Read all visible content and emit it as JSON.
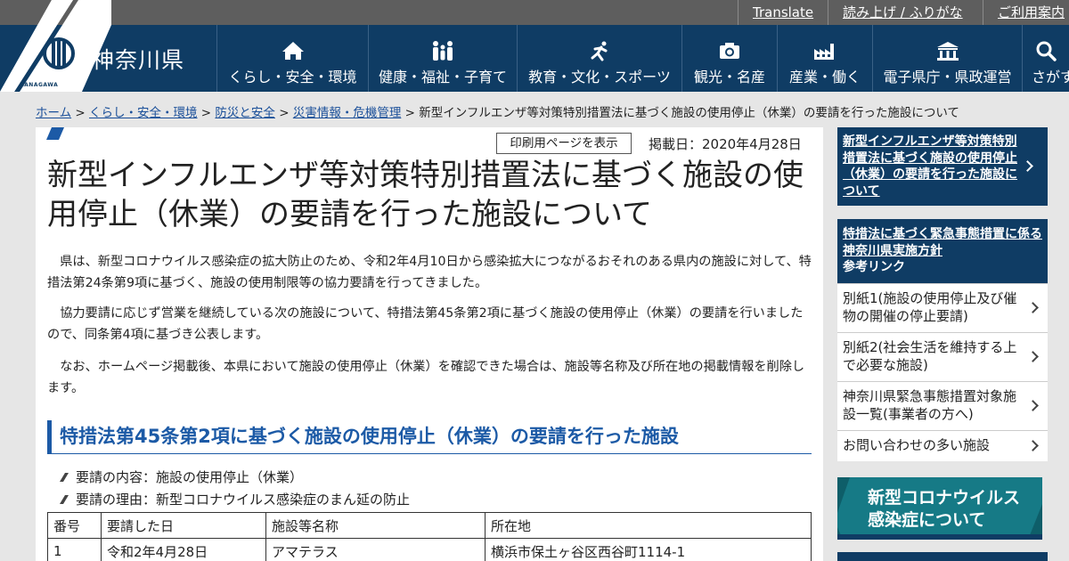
{
  "utility": {
    "translate": "Translate",
    "reading": "読み上げ / ふりがな",
    "guide": "ご利用案内"
  },
  "header": {
    "site_name": "神奈川県",
    "logo_sub": "KANAGAWA",
    "nav": [
      {
        "label": "くらし・安全・環境",
        "icon": "home-icon"
      },
      {
        "label": "健康・福祉・子育て",
        "icon": "family-icon"
      },
      {
        "label": "教育・文化・スポーツ",
        "icon": "runner-icon"
      },
      {
        "label": "観光・名産",
        "icon": "camera-icon"
      },
      {
        "label": "産業・働く",
        "icon": "factory-icon"
      },
      {
        "label": "電子県庁・県政運営",
        "icon": "government-building-icon"
      },
      {
        "label": "さがす",
        "icon": "search-icon"
      }
    ]
  },
  "breadcrumb": {
    "home": "ホーム",
    "sep": " > ",
    "l1": "くらし・安全・環境",
    "l2": "防災と安全",
    "l3": "災害情報・危機管理",
    "current": "新型インフルエンザ等対策特別措置法に基づく施設の使用停止（休業）の要請を行った施設について"
  },
  "article": {
    "print_label": "印刷用ページを表示",
    "pubdate": "掲載日：2020年4月28日",
    "title": "新型インフルエンザ等対策特別措置法に基づく施設の使用停止（休業）の要請を行った施設について",
    "paragraphs": [
      "　県は、新型コロナウイルス感染症の拡大防止のため、令和2年4月10日から感染拡大につながるおそれのある県内の施設に対して、特措法第24条第9項に基づく、施設の使用制限等の協力要請を行ってきました。",
      "　協力要請に応じず営業を継続している次の施設について、特措法第45条第2項に基づく施設の使用停止（休業）の要請を行いましたので、同条第4項に基づき公表します。",
      "　なお、ホームページ掲載後、本県において施設の使用停止（休業）を確認できた場合は、施設等名称及び所在地の掲載情報を削除します。"
    ],
    "section_heading": "特措法第45条第2項に基づく施設の使用停止（休業）の要請を行った施設",
    "bullets": [
      "要請の内容：施設の使用停止（休業）",
      "要請の理由：新型コロナウイルス感染症のまん延の防止"
    ],
    "table": {
      "headers": [
        "番号",
        "要請した日",
        "施設等名称",
        "所在地"
      ],
      "rows": [
        [
          "1",
          "令和2年4月28日",
          "アマテラス",
          "横浜市保土ヶ谷区西谷町1114-1"
        ]
      ]
    }
  },
  "sidebar": {
    "feature_link": "新型インフルエンザ等対策特別措置法に基づく施設の使用停止（休業）の要請を行った施設について",
    "box_head_link": "特措法に基づく緊急事態措置に係る神奈川県実施方針",
    "box_head_sub": "参考リンク",
    "links": [
      "別紙1(施設の使用停止及び催物の開催の停止要請)",
      "別紙2(社会生活を維持する上で必要な施設)",
      "神奈川県緊急事態措置対象施設一覧(事業者の方へ)",
      "お問い合わせの多い施設"
    ],
    "banner": {
      "line1": "新型コロナウイルス",
      "line2": "感染症について"
    }
  },
  "colors": {
    "header_bg": "#0f3c64",
    "utility_bg": "#5e5e5e",
    "accent_blue": "#1c5aa6",
    "banner_teal": "#167a86"
  }
}
